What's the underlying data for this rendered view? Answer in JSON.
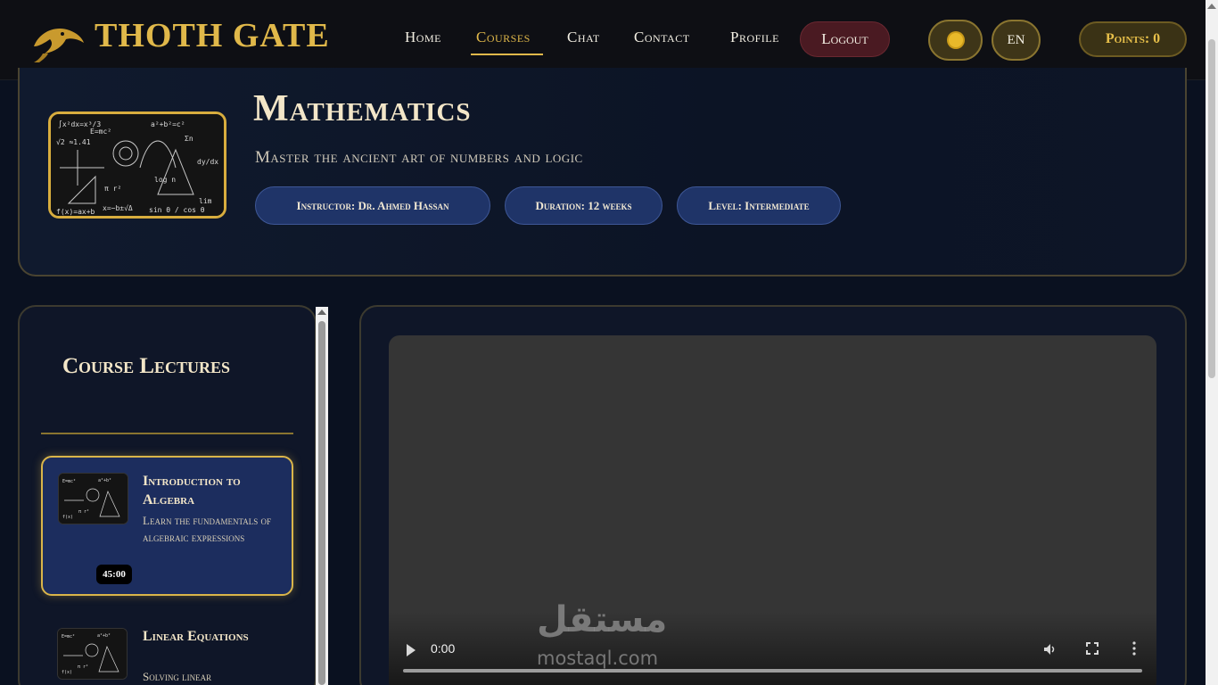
{
  "nav": {
    "brand": "THOTH GATE",
    "links": [
      "Home",
      "Courses",
      "Chat",
      "Contact",
      "Profile"
    ],
    "active": "Courses",
    "logout": "Logout",
    "theme_icon": "sun-icon",
    "language": "EN",
    "points": "Points: 0"
  },
  "course": {
    "title": "Mathematics",
    "subtitle": "Master the ancient art of numbers and logic",
    "instructor": "Instructor: Dr. Ahmed Hassan",
    "duration": "Duration: 12 weeks",
    "level": "Level: Intermediate"
  },
  "lectures": {
    "heading": "Course Lectures",
    "items": [
      {
        "title": "Introduction to Algebra",
        "description": "Learn the fundamentals of algebraic expressions",
        "duration": "45:00"
      },
      {
        "title": "Linear Equations",
        "description": "Solving linear"
      }
    ]
  },
  "video": {
    "time": "0:00",
    "progress": 0
  },
  "watermark": {
    "arabic": "مستقل",
    "url": "mostaql.com"
  },
  "colors": {
    "gold": "#e0b84a",
    "navy": "#0a1120",
    "tag_blue": "#1f3468",
    "logout_red": "#4a1a22"
  }
}
